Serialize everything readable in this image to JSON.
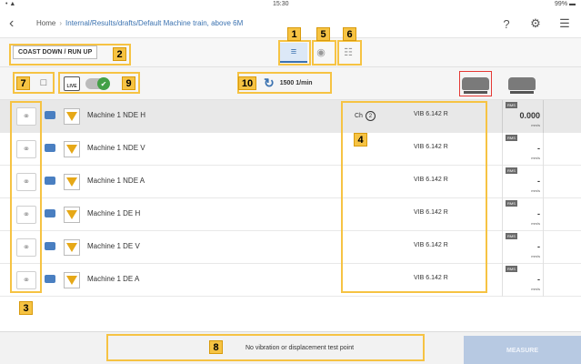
{
  "status": {
    "left": "• ▲",
    "time": "15:30",
    "battery": "99% ▬"
  },
  "nav": {
    "back": "‹",
    "home": "Home",
    "separator": "›",
    "path": "Internal/Results/drafts/Default Machine train, above 6",
    "path_tail": "M",
    "help_icon": "?",
    "settings_icon": "⚙",
    "menu_icon": "☰"
  },
  "toolbar": {
    "mode_label": "COAST DOWN / RUN UP",
    "view_tabs": [
      {
        "label": "≡",
        "name": "list-view",
        "active": true
      },
      {
        "label": "◉",
        "name": "visibility-view",
        "active": false
      },
      {
        "label": "☷",
        "name": "grid-view",
        "active": false
      }
    ]
  },
  "subbar": {
    "doc_icon": "□",
    "live_label": "LIVE",
    "live_check": "✔",
    "rpm_icon": "↻",
    "rpm_value": "1500 1/min"
  },
  "rows": [
    {
      "name": "Machine 1 NDE H",
      "ch_label": "Ch",
      "ch_num": "2",
      "sensor": "VIB 6.142 R",
      "rms": "RMS",
      "value": "0.000",
      "unit": "mm/s",
      "selected": true
    },
    {
      "name": "Machine 1 NDE V",
      "ch_label": "",
      "ch_num": "",
      "sensor": "VIB 6.142 R",
      "rms": "RMS",
      "value": "-",
      "unit": "mm/s",
      "selected": false
    },
    {
      "name": "Machine 1 NDE A",
      "ch_label": "",
      "ch_num": "",
      "sensor": "VIB 6.142 R",
      "rms": "RMS",
      "value": "-",
      "unit": "mm/s",
      "selected": false
    },
    {
      "name": "Machine 1 DE H",
      "ch_label": "",
      "ch_num": "",
      "sensor": "VIB 6.142 R",
      "rms": "RMS",
      "value": "-",
      "unit": "mm/s",
      "selected": false
    },
    {
      "name": "Machine 1 DE V",
      "ch_label": "",
      "ch_num": "",
      "sensor": "VIB 6.142 R",
      "rms": "RMS",
      "value": "-",
      "unit": "mm/s",
      "selected": false
    },
    {
      "name": "Machine 1 DE A",
      "ch_label": "",
      "ch_num": "",
      "sensor": "VIB 6.142 R",
      "rms": "RMS",
      "value": "-",
      "unit": "mm/s",
      "selected": false
    }
  ],
  "link_icon": "⚭",
  "bottom": {
    "message": "No vibration or displacement test point",
    "measure_label": "MEASURE"
  },
  "callouts": [
    "1",
    "2",
    "3",
    "4",
    "5",
    "6",
    "7",
    "8",
    "9",
    "10"
  ],
  "colors": {
    "accent": "#3b72b0",
    "callout": "#f6c343",
    "measure_disabled": "#b7c9e2",
    "live_ok": "#43a047",
    "selected_machine": "#e53935"
  }
}
